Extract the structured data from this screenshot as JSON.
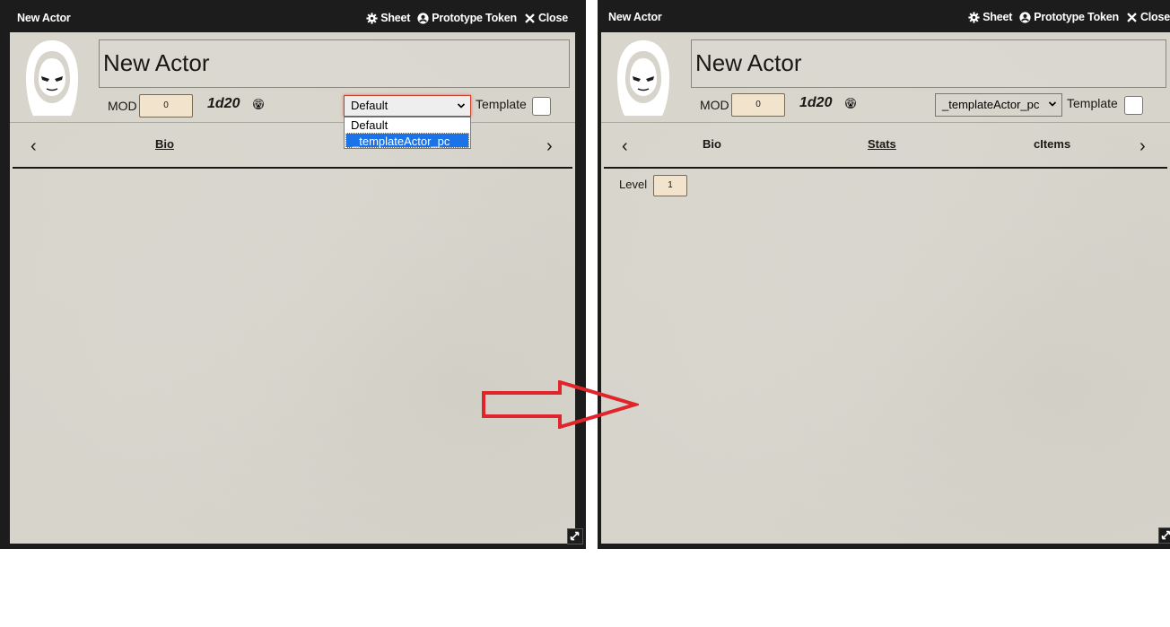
{
  "left": {
    "title": "New Actor",
    "controls": {
      "sheet": "Sheet",
      "token": "Prototype Token",
      "close": "Close"
    },
    "name": "New Actor",
    "mod_label": "MOD",
    "mod_value": "0",
    "dice": "1d20",
    "select_value": "Default",
    "dropdown_options": [
      "Default",
      "_templateActor_pc"
    ],
    "template_label": "Template",
    "tabs": [
      "Bio"
    ]
  },
  "right": {
    "title": "New Actor",
    "controls": {
      "sheet": "Sheet",
      "token": "Prototype Token",
      "close": "Close"
    },
    "name": "New Actor",
    "mod_label": "MOD",
    "mod_value": "0",
    "dice": "1d20",
    "select_value": "_templateActor_pc",
    "template_label": "Template",
    "tabs": [
      "Bio",
      "Stats",
      "cItems"
    ],
    "level_label": "Level",
    "level_value": "1"
  },
  "colors": {
    "window_bg": "#1c1c1c",
    "parchment": "#d6d4cb",
    "input_bg": "#f2e3cc",
    "arrow": "#e0242a",
    "select_highlight": "#1a73e8"
  }
}
